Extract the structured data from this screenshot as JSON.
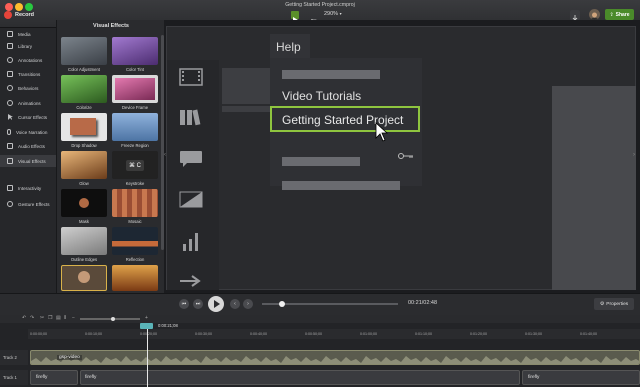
{
  "app": {
    "record_label": "Record",
    "window_title": "Getting Started Project.cmproj",
    "zoom_level": "290%",
    "share_label": "Share"
  },
  "sidebar": {
    "items": [
      {
        "label": "Media"
      },
      {
        "label": "Library"
      },
      {
        "label": "Annotations"
      },
      {
        "label": "Transitions"
      },
      {
        "label": "Behaviors"
      },
      {
        "label": "Animations"
      },
      {
        "label": "Cursor Effects"
      },
      {
        "label": "Voice Narration"
      },
      {
        "label": "Audio Effects"
      },
      {
        "label": "Visual Effects"
      },
      {
        "label": "Interactivity"
      },
      {
        "label": "Gesture Effects"
      }
    ]
  },
  "effects_panel": {
    "title": "Visual Effects",
    "items": [
      {
        "label": "Color Adjustment",
        "color": "#5f6770"
      },
      {
        "label": "Color Tint",
        "color": "#7c4fa8"
      },
      {
        "label": "Colorize",
        "color": "#4b8a39"
      },
      {
        "label": "Device Frame",
        "color": "#c14a83"
      },
      {
        "label": "Drop Shadow",
        "color": "#d9d9d9"
      },
      {
        "label": "Freeze Region",
        "color": "#6b95c7"
      },
      {
        "label": "Glow",
        "color": "#b9793f"
      },
      {
        "label": "Keystroke",
        "color": "#242424"
      },
      {
        "label": "Mask",
        "color": "#121212"
      },
      {
        "label": "Mosaic",
        "color": "#b86a48"
      },
      {
        "label": "Outline Edges",
        "color": "#a8a8a8"
      },
      {
        "label": "Reflection",
        "color": "#3c4a5a"
      },
      {
        "label": "",
        "color": "#6b5c4a"
      },
      {
        "label": "",
        "color": "#a86f2a"
      }
    ],
    "keystroke_glyph": "⌘ C"
  },
  "canvas": {
    "help_title": "Help",
    "menu_items": [
      "Video Tutorials",
      "Getting Started Project"
    ],
    "highlight_color": "#8fc53f"
  },
  "playback": {
    "time_display": "00:21/02:48",
    "properties_label": "Properties"
  },
  "timeline": {
    "playhead_time": "0:00:21;08",
    "ruler_ticks": [
      "0:00:00;00",
      "0:00:10;00",
      "0:00:20;00",
      "0:00:30;00",
      "0:00:40;00",
      "0:00:50;00",
      "0:01:00;00",
      "0:01:10;00",
      "0:01:20;00",
      "0:01:30;00",
      "0:01:40;00"
    ],
    "tracks": [
      {
        "label": "Track 2",
        "clips": [
          "gsp-video"
        ]
      },
      {
        "label": "Track 1",
        "clips": [
          "firefly",
          "firefly",
          "firefly"
        ]
      }
    ]
  }
}
